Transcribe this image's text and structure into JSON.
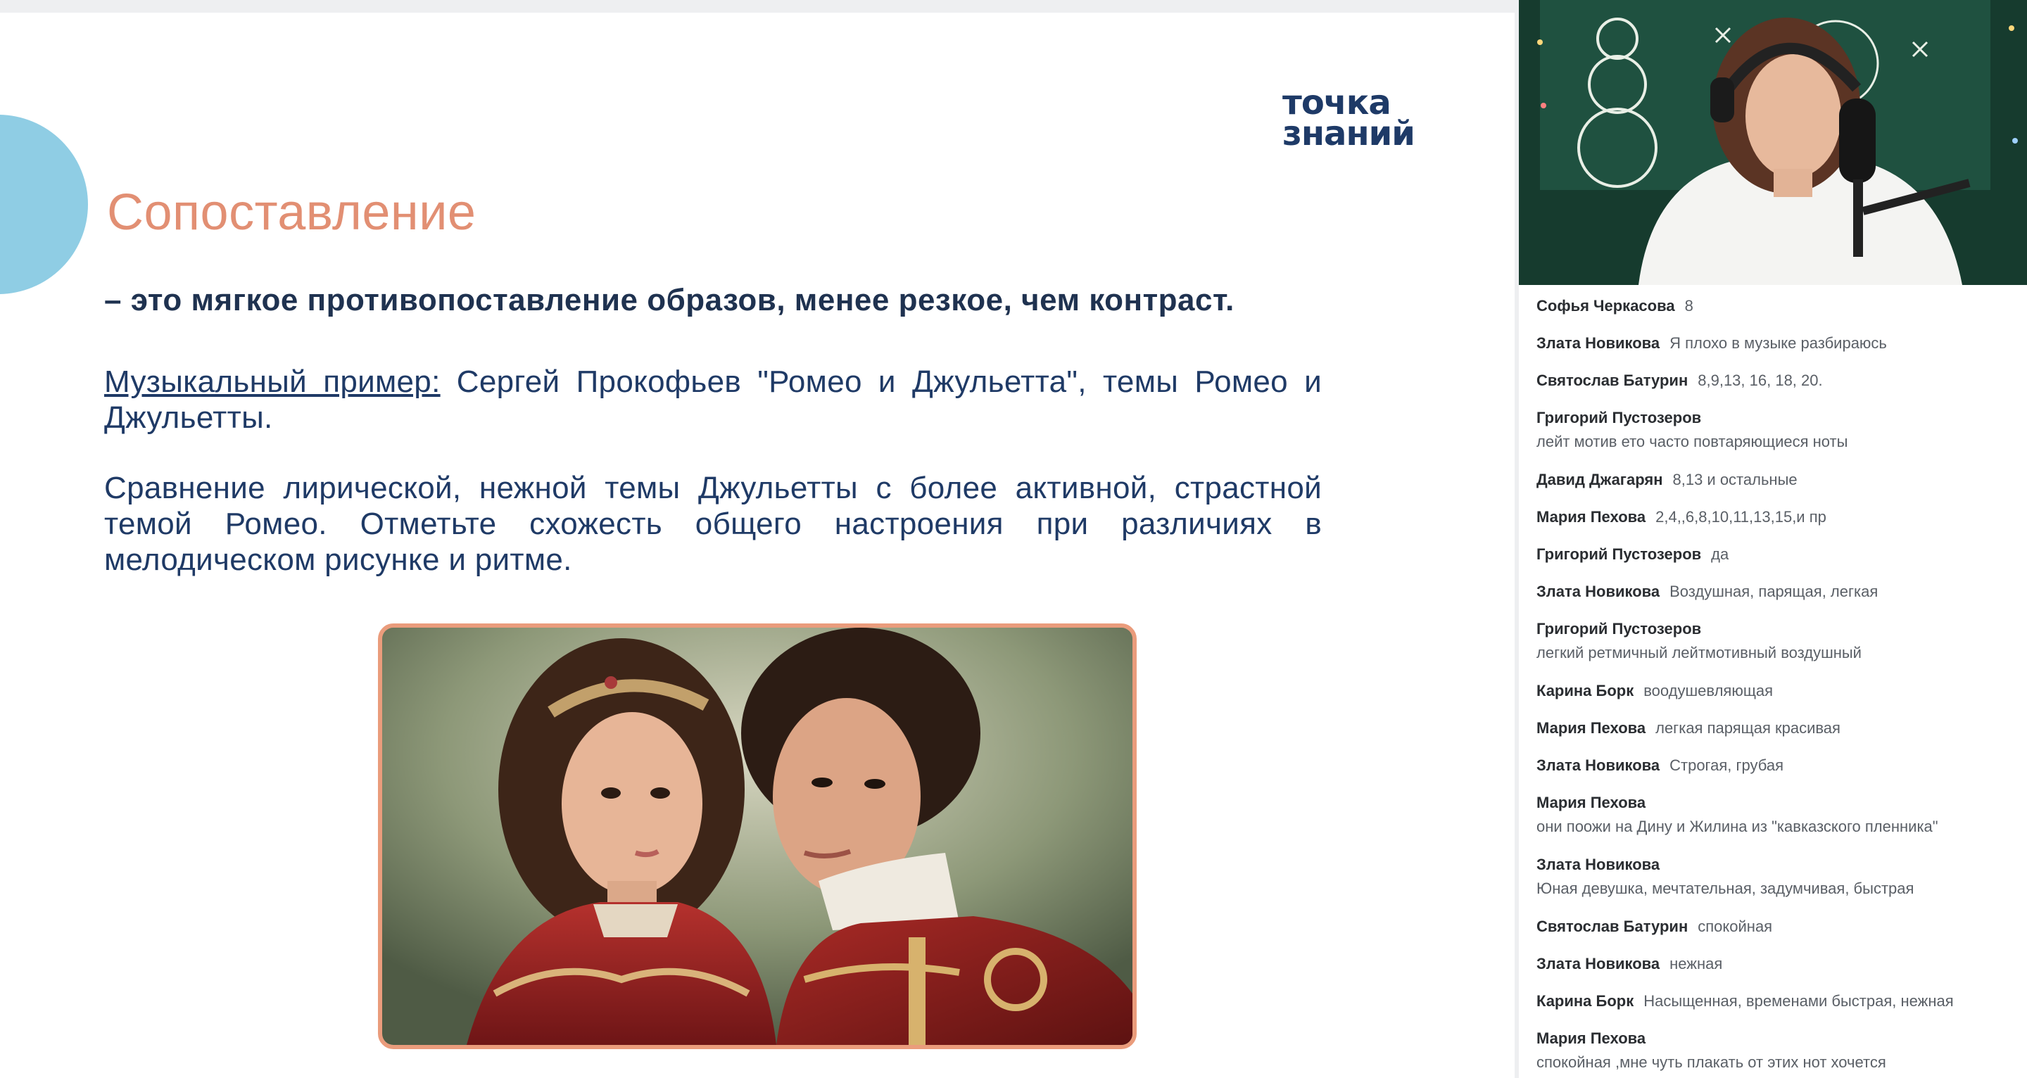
{
  "slide": {
    "logo_line1": "точка",
    "logo_line2": "знаний",
    "title": "Сопоставление",
    "definition": "– это мягкое противопоставление образов, менее резкое, чем контраст.",
    "example_label": "Музыкальный пример:",
    "example_text": " Сергей Прокофьев \"Ромео и Джульетта\", темы Ромео и Джульетты.",
    "comparison_text": "Сравнение лирической, нежной темы Джульетты с более активной, страстной темой Ромео. Отметьте схожесть общего настроения при различиях в мелодическом рисунке и ритме."
  },
  "chat": {
    "messages": [
      {
        "author": "Софья Черкасова",
        "text": "8"
      },
      {
        "author": "Злата Новикова",
        "text": "Я плохо в музыке разбираюсь"
      },
      {
        "author": "Святослав Батурин",
        "text": "8,9,13, 16, 18, 20."
      },
      {
        "author": "Григорий Пустозеров",
        "text": "лейт мотив ето часто повтаряющиеся ноты"
      },
      {
        "author": "Давид Джагарян",
        "text": "8,13 и остальные"
      },
      {
        "author": "Мария Пехова",
        "text": "2,4,,6,8,10,11,13,15,и пр"
      },
      {
        "author": "Григорий Пустозеров",
        "text": "да"
      },
      {
        "author": "Злата Новикова",
        "text": "Воздушная, парящая, легкая"
      },
      {
        "author": "Григорий Пустозеров",
        "text": "легкий ретмичный лейтмотивный воздушный"
      },
      {
        "author": "Карина Борк",
        "text": "воодушевляющая"
      },
      {
        "author": "Мария Пехова",
        "text": "легкая парящая красивая"
      },
      {
        "author": "Злата Новикова",
        "text": "Строгая, грубая"
      },
      {
        "author": "Мария Пехова",
        "text": "они поожи на Дину и Жилина из \"кавказского пленника\""
      },
      {
        "author": "Злата Новикова",
        "text": "Юная девушка, мечтательная, задумчивая, быстрая"
      },
      {
        "author": "Святослав Батурин",
        "text": "спокойная"
      },
      {
        "author": "Злата Новикова",
        "text": "нежная"
      },
      {
        "author": "Карина Борк",
        "text": "Насыщенная, временами быстрая, нежная"
      },
      {
        "author": "Мария Пехова",
        "text": "спокойная ,мне чуть плакать от этих нот хочется"
      }
    ]
  }
}
